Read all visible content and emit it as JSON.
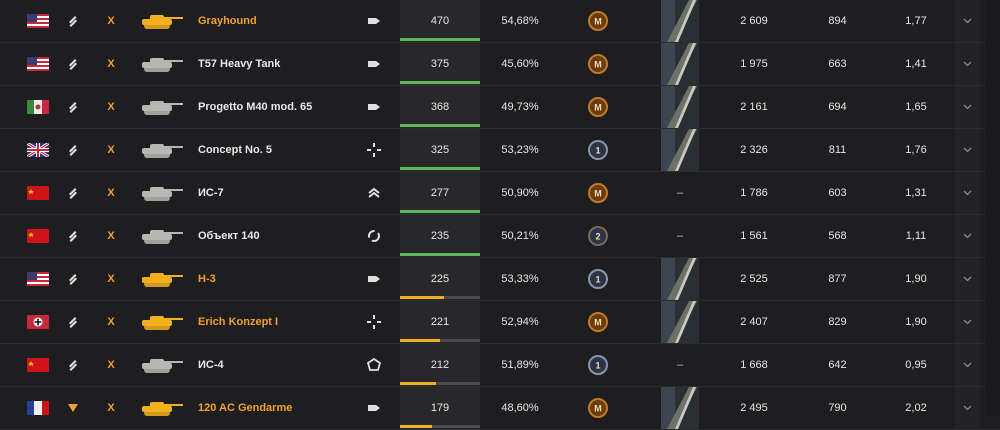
{
  "colors": {
    "accent": "#f0a030",
    "green": "#5cb85c",
    "yellow": "#f0b020",
    "gray": "#4b4b4d"
  },
  "rows": [
    {
      "nation": "usa",
      "rank": "rank-icon",
      "tier": "X",
      "premium": true,
      "name": "Grayhound",
      "class": "lt",
      "battles": "470",
      "progress": 1.0,
      "progress_color": "green",
      "winrate": "54,68%",
      "mastery": "M",
      "marks": "gun-marks",
      "dmg": "2 609",
      "xp": "894",
      "wn": "1,77"
    },
    {
      "nation": "usa",
      "rank": "rank-icon",
      "tier": "X",
      "premium": false,
      "name": "T57 Heavy Tank",
      "class": "lt",
      "battles": "375",
      "progress": 1.0,
      "progress_color": "green",
      "winrate": "45,60%",
      "mastery": "M",
      "marks": "gun-marks",
      "dmg": "1 975",
      "xp": "663",
      "wn": "1,41"
    },
    {
      "nation": "italy",
      "rank": "rank-icon",
      "tier": "X",
      "premium": false,
      "name": "Progetto M40 mod. 65",
      "class": "lt",
      "battles": "368",
      "progress": 1.0,
      "progress_color": "green",
      "winrate": "49,73%",
      "mastery": "M",
      "marks": "gun-marks",
      "dmg": "2 161",
      "xp": "694",
      "wn": "1,65"
    },
    {
      "nation": "uk",
      "rank": "rank-icon",
      "tier": "X",
      "premium": false,
      "name": "Concept No. 5",
      "class": "td",
      "battles": "325",
      "progress": 1.0,
      "progress_color": "green",
      "winrate": "53,23%",
      "mastery": "1",
      "marks": "gun-marks",
      "dmg": "2 326",
      "xp": "811",
      "wn": "1,76"
    },
    {
      "nation": "ussr",
      "rank": "rank-icon",
      "tier": "X",
      "premium": false,
      "name": "ИС-7",
      "class": "ht",
      "battles": "277",
      "progress": 1.0,
      "progress_color": "green",
      "winrate": "50,90%",
      "mastery": "M",
      "marks": "–",
      "dmg": "1 786",
      "xp": "603",
      "wn": "1,31"
    },
    {
      "nation": "ussr",
      "rank": "rank-icon",
      "tier": "X",
      "premium": false,
      "name": "Объект 140",
      "class": "mt",
      "battles": "235",
      "progress": 1.0,
      "progress_color": "green",
      "winrate": "50,21%",
      "mastery": "2",
      "marks": "–",
      "dmg": "1 561",
      "xp": "568",
      "wn": "1,11"
    },
    {
      "nation": "usa",
      "rank": "rank-icon",
      "tier": "X",
      "premium": true,
      "name": "H-3",
      "class": "lt",
      "battles": "225",
      "progress": 0.55,
      "progress_color": "yellow",
      "winrate": "53,33%",
      "mastery": "1",
      "marks": "gun-marks",
      "dmg": "2 525",
      "xp": "877",
      "wn": "1,90"
    },
    {
      "nation": "germany",
      "rank": "rank-icon",
      "tier": "X",
      "premium": true,
      "name": "Erich Konzept I",
      "class": "td",
      "battles": "221",
      "progress": 0.5,
      "progress_color": "yellow",
      "winrate": "52,94%",
      "mastery": "M",
      "marks": "gun-marks",
      "dmg": "2 407",
      "xp": "829",
      "wn": "1,90"
    },
    {
      "nation": "ussr",
      "rank": "rank-icon",
      "tier": "X",
      "premium": false,
      "name": "ИС-4",
      "class": "spg",
      "battles": "212",
      "progress": 0.45,
      "progress_color": "yellow",
      "winrate": "51,89%",
      "mastery": "1",
      "marks": "–",
      "dmg": "1 668",
      "xp": "642",
      "wn": "0,95"
    },
    {
      "nation": "france",
      "rank": "rank-icon-down",
      "tier": "X",
      "premium": true,
      "name": "120 AC Gendarme",
      "class": "lt",
      "battles": "179",
      "progress": 0.4,
      "progress_color": "yellow",
      "winrate": "48,60%",
      "mastery": "M",
      "marks": "gun-marks",
      "dmg": "2 495",
      "xp": "790",
      "wn": "2,02"
    }
  ]
}
